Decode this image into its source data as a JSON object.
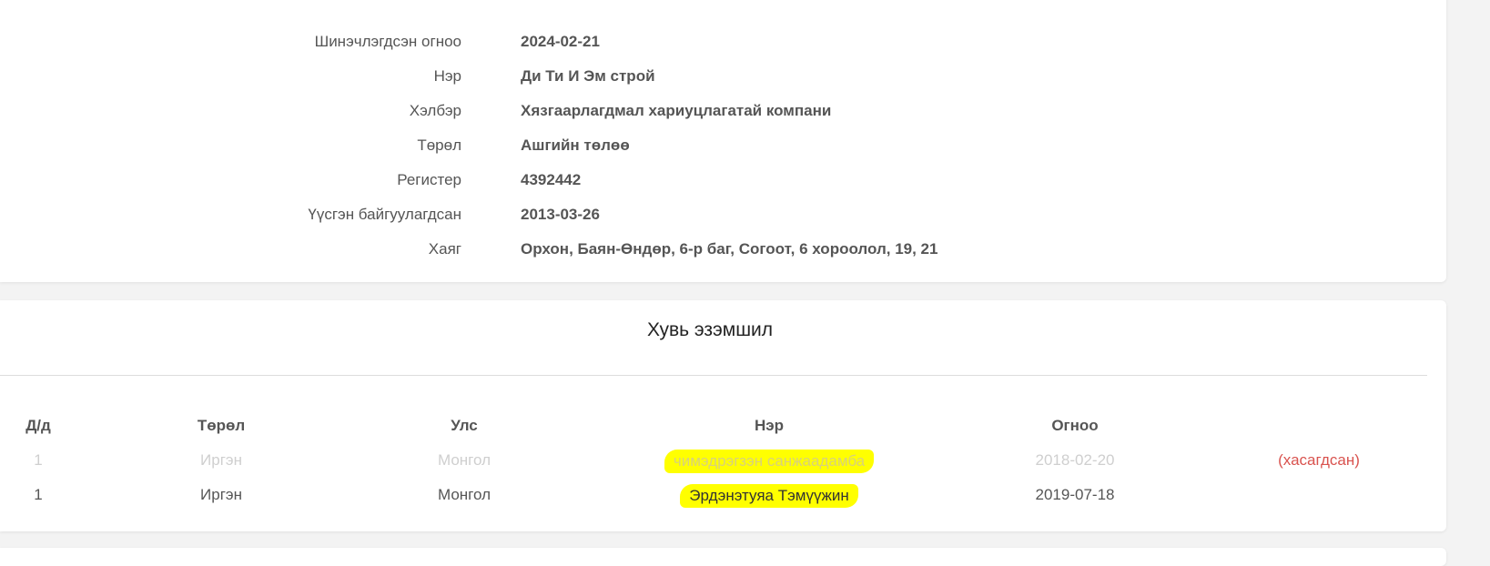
{
  "company_info": {
    "rows": [
      {
        "label": "Шинэчлэгдсэн огноо",
        "value": "2024-02-21"
      },
      {
        "label": "Нэр",
        "value": "Ди Ти И Эм строй"
      },
      {
        "label": "Хэлбэр",
        "value": "Хязгаарлагдмал хариуцлагатай компани"
      },
      {
        "label": "Төрөл",
        "value": "Ашгийн төлөө"
      },
      {
        "label": "Регистер",
        "value": "4392442"
      },
      {
        "label": "Үүсгэн байгуулагдсан",
        "value": "2013-03-26"
      },
      {
        "label": "Хаяг",
        "value": "Орхон, Баян-Өндөр, 6-р баг, Согоот, 6 хороолол, 19, 21"
      }
    ]
  },
  "ownership": {
    "title": "Хувь эзэмшил",
    "columns": [
      "Д/д",
      "Төрөл",
      "Улс",
      "Нэр",
      "Огноо"
    ],
    "rows": [
      {
        "index": "1",
        "type": "Иргэн",
        "country": "Монгол",
        "name": "чимэдрэгзэн санжаадамба",
        "date": "2018-02-20",
        "status": "(хасагдсан)"
      },
      {
        "index": "1",
        "type": "Иргэн",
        "country": "Монгол",
        "name": "Эрдэнэтуяа Тэмүүжин",
        "date": "2019-07-18",
        "status": ""
      }
    ]
  },
  "colors": {
    "highlight": "#ffff00",
    "removed_text": "#d9534f",
    "muted_text": "#cfcfcf"
  }
}
